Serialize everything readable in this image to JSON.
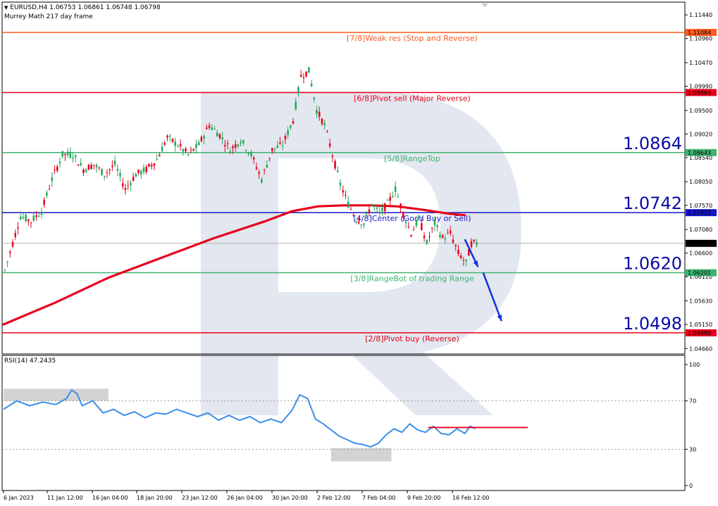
{
  "header": {
    "symbol_line": "EURUSD,H4  1.06753 1.06861 1.06748 1.06798",
    "indicator_name": "Murrey Math 217 day frame",
    "rsi_label": "RSI(14) 47.2435"
  },
  "colors": {
    "bull": "#26a65b",
    "bear": "#e8001c",
    "ma": "#e8001c",
    "rsi": "#3b8ee8",
    "arrow": "#1034d8",
    "watermark": "#e3e7ef"
  },
  "chart_data": [
    {
      "type": "candlestick",
      "title": "EURUSD,H4",
      "ylim": [
        1.0455,
        1.117
      ],
      "y_ticks": [
        "1.11440",
        "1.10960",
        "1.10470",
        "1.09990",
        "1.09500",
        "1.09020",
        "1.08540",
        "1.08050",
        "1.07570",
        "1.07080",
        "1.06600",
        "1.06120",
        "1.05630",
        "1.05150",
        "1.04660"
      ],
      "x_ticks": [
        "6 Jan 2023",
        "11 Jan 12:00",
        "16 Jan 04:00",
        "18 Jan 20:00",
        "23 Jan 12:00",
        "26 Jan 04:00",
        "30 Jan 20:00",
        "2 Feb 12:00",
        "7 Feb 04:00",
        "9 Feb 20:00",
        "16 Feb 12:00"
      ],
      "price_path": [
        [
          0,
          1.0625
        ],
        [
          3,
          1.068
        ],
        [
          6,
          1.0735
        ],
        [
          10,
          1.0725
        ],
        [
          14,
          1.0745
        ],
        [
          18,
          1.081
        ],
        [
          22,
          1.086
        ],
        [
          26,
          1.086
        ],
        [
          30,
          1.083
        ],
        [
          34,
          1.084
        ],
        [
          38,
          1.082
        ],
        [
          42,
          1.084
        ],
        [
          46,
          1.079
        ],
        [
          50,
          1.082
        ],
        [
          54,
          1.083
        ],
        [
          58,
          1.085
        ],
        [
          62,
          1.0895
        ],
        [
          66,
          1.088
        ],
        [
          70,
          1.086
        ],
        [
          74,
          1.088
        ],
        [
          78,
          1.092
        ],
        [
          82,
          1.09
        ],
        [
          86,
          1.087
        ],
        [
          90,
          1.089
        ],
        [
          94,
          1.086
        ],
        [
          98,
          1.081
        ],
        [
          102,
          1.087
        ],
        [
          106,
          1.088
        ],
        [
          110,
          1.093
        ],
        [
          113,
          1.102
        ],
        [
          116,
          1.103
        ],
        [
          119,
          1.095
        ],
        [
          122,
          1.092
        ],
        [
          125,
          1.086
        ],
        [
          128,
          1.08
        ],
        [
          131,
          1.076
        ],
        [
          134,
          1.073
        ],
        [
          137,
          1.072
        ],
        [
          140,
          1.076
        ],
        [
          143,
          1.074
        ],
        [
          146,
          1.076
        ],
        [
          149,
          1.079
        ],
        [
          152,
          1.074
        ],
        [
          155,
          1.07
        ],
        [
          158,
          1.073
        ],
        [
          161,
          1.068
        ],
        [
          164,
          1.072
        ],
        [
          167,
          1.069
        ],
        [
          170,
          1.07
        ],
        [
          173,
          1.066
        ],
        [
          176,
          1.064
        ],
        [
          178,
          1.068
        ],
        [
          180,
          1.068
        ]
      ],
      "levels": [
        {
          "value": 1.11084,
          "label": "[7/8]Weak res (Stop and Reverse)",
          "price_tag": "1.11084",
          "color": "#ff5a1e",
          "text_color": "#ff5a1e"
        },
        {
          "value": 1.09863,
          "label": "[6/8]Pivot sell (Major Reverse)",
          "price_tag": "1.09863",
          "color": "#e8001c",
          "text_color": "#e8001c"
        },
        {
          "value": 1.08643,
          "label": "[5/8]RangeTop",
          "price_tag": "1.08643",
          "color": "#3cb371",
          "text_color": "#3cb371",
          "big_label": "1.0864"
        },
        {
          "value": 1.07422,
          "label": "[4/8]Center (Good Buy or Sell)",
          "price_tag": "1.07422",
          "color": "#1616c8",
          "text_color": "#1616c8",
          "big_label": "1.0742"
        },
        {
          "value": 1.06201,
          "label": "[3/8]RangeBot of trading Range",
          "price_tag": "1.06201",
          "color": "#3cb371",
          "text_color": "#3cb371",
          "big_label": "1.0620"
        },
        {
          "value": 1.0498,
          "label": "[2/8]Pivot buy (Reverse)",
          "price_tag": "1.04980",
          "color": "#e8001c",
          "text_color": "#e8001c",
          "big_label": "1.0498"
        }
      ],
      "current_price": {
        "value": 1.06798,
        "price_tag": "1.06798"
      },
      "moving_average": [
        [
          0,
          1.0515
        ],
        [
          20,
          1.056
        ],
        [
          40,
          1.061
        ],
        [
          60,
          1.065
        ],
        [
          80,
          1.069
        ],
        [
          100,
          1.0725
        ],
        [
          110,
          1.0745
        ],
        [
          120,
          1.0755
        ],
        [
          130,
          1.0757
        ],
        [
          140,
          1.0757
        ],
        [
          150,
          1.0755
        ],
        [
          160,
          1.0748
        ],
        [
          170,
          1.074
        ],
        [
          176,
          1.0737
        ]
      ],
      "forecast_arrow": [
        [
          176,
          1.0688
        ],
        [
          181,
          1.0632
        ],
        [
          183,
          1.062
        ],
        [
          190,
          1.0522
        ]
      ]
    },
    {
      "type": "line",
      "title": "RSI(14) 47.2435",
      "ylim": [
        0,
        100
      ],
      "y_ticks": [
        "100",
        "70",
        "30",
        "0"
      ],
      "levels": [
        70,
        30
      ],
      "rsi_path": [
        [
          0,
          63
        ],
        [
          5,
          70
        ],
        [
          10,
          66
        ],
        [
          15,
          69
        ],
        [
          20,
          67
        ],
        [
          24,
          72
        ],
        [
          26,
          79
        ],
        [
          28,
          76
        ],
        [
          30,
          66
        ],
        [
          34,
          70
        ],
        [
          38,
          60
        ],
        [
          42,
          63
        ],
        [
          46,
          58
        ],
        [
          50,
          61
        ],
        [
          54,
          56
        ],
        [
          58,
          60
        ],
        [
          62,
          59
        ],
        [
          66,
          63
        ],
        [
          70,
          60
        ],
        [
          74,
          57
        ],
        [
          78,
          60
        ],
        [
          82,
          54
        ],
        [
          86,
          58
        ],
        [
          90,
          54
        ],
        [
          94,
          57
        ],
        [
          98,
          52
        ],
        [
          102,
          55
        ],
        [
          106,
          52
        ],
        [
          110,
          62
        ],
        [
          113,
          75
        ],
        [
          116,
          72
        ],
        [
          119,
          55
        ],
        [
          122,
          51
        ],
        [
          125,
          46
        ],
        [
          128,
          41
        ],
        [
          131,
          38
        ],
        [
          134,
          35
        ],
        [
          137,
          34
        ],
        [
          140,
          32
        ],
        [
          143,
          35
        ],
        [
          146,
          42
        ],
        [
          149,
          47
        ],
        [
          152,
          44
        ],
        [
          155,
          51
        ],
        [
          158,
          46
        ],
        [
          161,
          44
        ],
        [
          164,
          49
        ],
        [
          167,
          43
        ],
        [
          170,
          42
        ],
        [
          173,
          47
        ],
        [
          176,
          43
        ],
        [
          178,
          49
        ],
        [
          180,
          47
        ]
      ],
      "resistance_line": [
        [
          162,
          48
        ],
        [
          200,
          48
        ]
      ],
      "highlight_zones": [
        {
          "x0": 0,
          "x1": 40,
          "y0": 70,
          "y1": 80
        },
        {
          "x0": 125,
          "x1": 148,
          "y0": 20,
          "y1": 31
        }
      ]
    }
  ]
}
